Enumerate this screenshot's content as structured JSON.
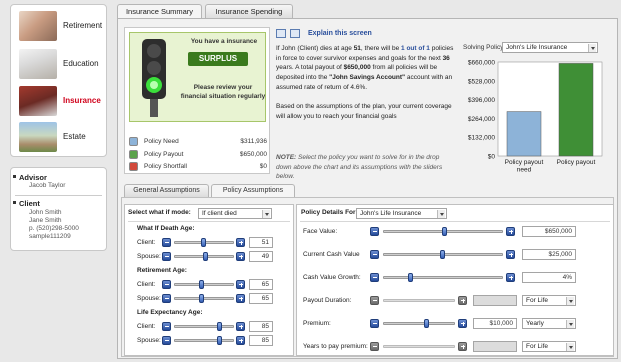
{
  "nav": {
    "items": [
      {
        "label": "Retirement",
        "active": false
      },
      {
        "label": "Education",
        "active": false
      },
      {
        "label": "Insurance",
        "active": true
      },
      {
        "label": "Estate",
        "active": false
      }
    ]
  },
  "people": {
    "advisor_heading": "Advisor",
    "advisor_name": "Jacob Taylor",
    "client_heading": "Client",
    "client_lines": [
      "John Smith",
      "Jane Smith",
      "p. (520)298-5000",
      "sample111209"
    ]
  },
  "tabs": {
    "summary": "Insurance Summary",
    "spending": "Insurance Spending"
  },
  "status": {
    "have_text": "You have a insurance",
    "badge": "SURPLUS",
    "message": "Please review your financial situation regularly"
  },
  "legend": [
    {
      "name": "Policy Need",
      "value": "$311,936",
      "color": "#8db3d8"
    },
    {
      "name": "Policy Payout",
      "value": "$650,000",
      "color": "#5aa24a"
    },
    {
      "name": "Policy Shortfall",
      "value": "$0",
      "color": "#d24a3b"
    }
  ],
  "explain": {
    "link": "Explain this screen",
    "p1_a": "If John (Client) dies at age ",
    "p1_age": "51",
    "p1_b": ", there will be ",
    "p1_count": "1 out of 1",
    "p1_c": " policies in force to cover survivor expenses and goals for the next ",
    "p1_years": "36",
    "p1_d": " years. A total payout of ",
    "p1_amount": "$650,000",
    "p1_e": " from all policies will be deposited into the ",
    "p1_acct": "\"John Savings Account\"",
    "p1_f": " account with an assumed rate of return of 4.6%.",
    "p2": "Based on the assumptions of the plan, your current coverage will allow you to reach your financial goals",
    "note_label": "NOTE:",
    "note": " Select the policy you want to solve for in the drop down above the chart and its assumptions with the sliders below."
  },
  "solving": {
    "label": "Solving Policy:",
    "value": "John's Life Insurance"
  },
  "chart_data": {
    "type": "bar",
    "categories": [
      "Policy payout need",
      "Policy payout"
    ],
    "values": [
      311936,
      650000
    ],
    "colors": [
      "#8db3d8",
      "#3f8f36"
    ],
    "yticks": [
      "$660,000",
      "$528,000",
      "$396,000",
      "$264,000",
      "$132,000",
      "$0"
    ],
    "ylim": [
      0,
      660000
    ]
  },
  "subtabs": {
    "general": "General Assumptions",
    "policy": "Policy Assumptions"
  },
  "left": {
    "mode_label": "Select what if mode:",
    "mode_value": "If client died",
    "death_heading": "What If Death Age:",
    "retire_heading": "Retirement Age:",
    "life_heading": "Life Expectancy Age:",
    "client_label": "Client:",
    "spouse_label": "Spouse:",
    "death_client": "51",
    "death_spouse": "49",
    "retire_client": "65",
    "retire_spouse": "65",
    "life_client": "85",
    "life_spouse": "85"
  },
  "right": {
    "details_label": "Policy Details For:",
    "details_value": "John's Life Insurance",
    "face_label": "Face Value:",
    "face_value": "$650,000",
    "cash_label": "Current Cash Value",
    "cash_value": "$25,000",
    "growth_label": "Cash Value Growth:",
    "growth_value": "4%",
    "payout_label": "Payout Duration:",
    "payout_value": "",
    "payout_select": "For Life",
    "premium_label": "Premium:",
    "premium_value": "$10,000",
    "premium_select": "Yearly",
    "ytp_label": "Years to pay premium:",
    "ytp_value": "",
    "ytp_select": "For Life"
  }
}
